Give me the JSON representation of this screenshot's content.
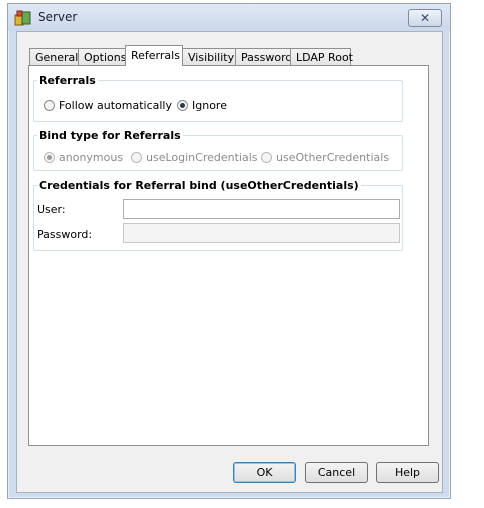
{
  "window": {
    "title": "Server",
    "close_glyph": "✕",
    "icon": "app-icon"
  },
  "tabs": [
    {
      "label": "General",
      "active": false
    },
    {
      "label": "Options",
      "active": false
    },
    {
      "label": "Referrals",
      "active": true
    },
    {
      "label": "Visibility",
      "active": false
    },
    {
      "label": "Password",
      "active": false
    },
    {
      "label": "LDAP Root",
      "active": false
    }
  ],
  "referrals": {
    "legend": "Referrals",
    "options": [
      {
        "label": "Follow automatically",
        "checked": false,
        "enabled": true
      },
      {
        "label": "Ignore",
        "checked": true,
        "enabled": true
      }
    ]
  },
  "bind_type": {
    "legend": "Bind type for Referrals",
    "options": [
      {
        "label": "anonymous",
        "checked": true,
        "enabled": false
      },
      {
        "label": "useLoginCredentials",
        "checked": false,
        "enabled": false
      },
      {
        "label": "useOtherCredentials",
        "checked": false,
        "enabled": false
      }
    ]
  },
  "credentials": {
    "legend": "Credentials for Referral bind (useOtherCredentials)",
    "user_label": "User:",
    "user_value": "",
    "password_label": "Password:",
    "password_value": ""
  },
  "buttons": {
    "ok": "OK",
    "cancel": "Cancel",
    "help": "Help"
  }
}
